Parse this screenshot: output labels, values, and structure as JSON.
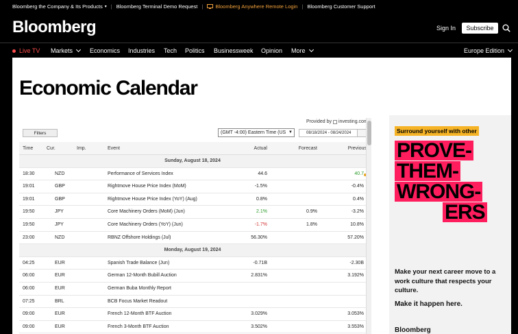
{
  "topbar": {
    "items": [
      "Bloomberg the Company & Its Products",
      "Bloomberg Terminal Demo Request",
      "Bloomberg Anywhere Remote Login",
      "Bloomberg Customer Support"
    ],
    "caret": "▾"
  },
  "header": {
    "logo": "Bloomberg",
    "signin": "Sign In",
    "subscribe": "Subscribe"
  },
  "nav": {
    "live": "Live TV",
    "items": [
      "Markets",
      "Economics",
      "Industries",
      "Tech",
      "Politics",
      "Businessweek",
      "Opinion",
      "More"
    ],
    "edition": "Europe Edition"
  },
  "page": {
    "title": "Economic Calendar"
  },
  "widget": {
    "provided_by": "Provided by",
    "provider": "investing.com",
    "filters_label": "Filters",
    "timezone": "(GMT -4:00) Eastern Time (US",
    "date_range": "08/18/2024 - 08/24/2024",
    "columns": [
      "Time",
      "Cur.",
      "Imp.",
      "Event",
      "Actual",
      "Forecast",
      "Previous"
    ],
    "rows": [
      {
        "day": "Sunday, August 18, 2024"
      },
      {
        "time": "18:30",
        "cur": "NZD",
        "event": "Performance of Services Index",
        "actual": "44.6",
        "forecast": "",
        "previous": "40.7",
        "prev_class": "green",
        "revised": true
      },
      {
        "time": "19:01",
        "cur": "GBP",
        "event": "Rightmove House Price Index (MoM)",
        "actual": "-1.5%",
        "forecast": "",
        "previous": "-0.4%"
      },
      {
        "time": "19:01",
        "cur": "GBP",
        "event": "Rightmove House Price Index (YoY) (Aug)",
        "actual": "0.8%",
        "forecast": "",
        "previous": "0.4%"
      },
      {
        "time": "19:50",
        "cur": "JPY",
        "event": "Core Machinery Orders (MoM) (Jun)",
        "actual": "2.1%",
        "actual_class": "green",
        "forecast": "0.9%",
        "previous": "-3.2%"
      },
      {
        "time": "19:50",
        "cur": "JPY",
        "event": "Core Machinery Orders (YoY) (Jun)",
        "actual": "-1.7%",
        "actual_class": "red",
        "forecast": "1.8%",
        "previous": "10.8%"
      },
      {
        "time": "23:00",
        "cur": "NZD",
        "event": "RBNZ Offshore Holdings (Jul)",
        "actual": "56.30%",
        "forecast": "",
        "previous": "57.20%"
      },
      {
        "day": "Monday, August 19, 2024"
      },
      {
        "time": "04:25",
        "cur": "EUR",
        "event": "Spanish Trade Balance (Jun)",
        "actual": "-0.71B",
        "forecast": "",
        "previous": "-2.30B"
      },
      {
        "time": "06:00",
        "cur": "EUR",
        "event": "German 12-Month Bubill Auction",
        "actual": "2.831%",
        "forecast": "",
        "previous": "3.192%"
      },
      {
        "time": "06:00",
        "cur": "EUR",
        "event": "German Buba Monthly Report",
        "actual": "",
        "forecast": "",
        "previous": ""
      },
      {
        "time": "07:25",
        "cur": "BRL",
        "event": "BCB Focus Market Readout",
        "actual": "",
        "forecast": "",
        "previous": ""
      },
      {
        "time": "09:00",
        "cur": "EUR",
        "event": "French 12-Month BTF Auction",
        "actual": "3.029%",
        "forecast": "",
        "previous": "3.053%"
      },
      {
        "time": "09:00",
        "cur": "EUR",
        "event": "French 3-Month BTF Auction",
        "actual": "3.502%",
        "forecast": "",
        "previous": "3.553%"
      }
    ]
  },
  "ad": {
    "tag": "Surround yourself with other",
    "poster": [
      "PROVE-",
      "THEM-",
      "WRONG-",
      "ERS"
    ],
    "copy": "Make your next career move to a work culture that respects your culture.",
    "cta": "Make it happen here.",
    "brand": "Bloomberg"
  },
  "colors": {
    "accent_orange": "#f2a13c",
    "live_red": "#ff4d4d",
    "ad_pink": "#ff1d5e",
    "ad_yellow": "#f5b325",
    "positive": "#2a9a2a",
    "negative": "#d13131"
  }
}
